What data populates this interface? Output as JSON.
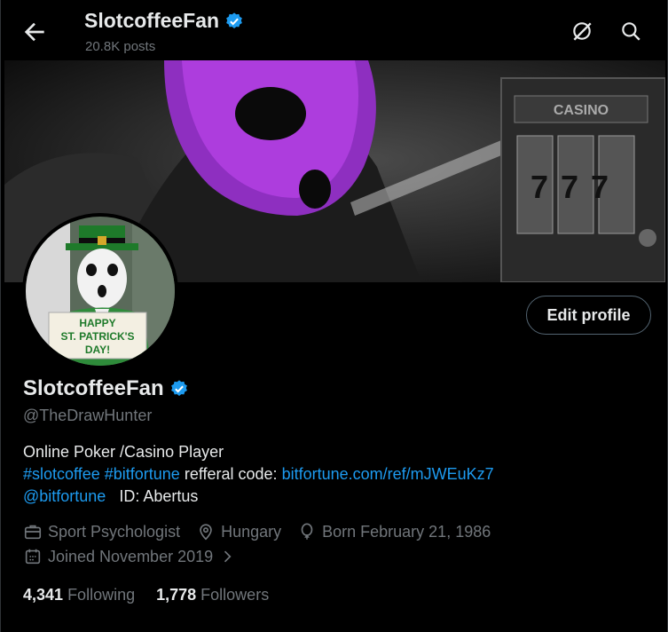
{
  "header": {
    "title": "SlotcoffeeFan",
    "posts": "20.8K posts"
  },
  "profile": {
    "edit_label": "Edit profile",
    "name": "SlotcoffeeFan",
    "handle": "@TheDrawHunter",
    "avatar_sign": [
      "HAPPY",
      "ST. PATRICK'S",
      "DAY!"
    ],
    "banner_sign": "CASINO",
    "banner_reels": "777",
    "bio": {
      "line1": "Online Poker /Casino Player",
      "hashtag1": "#slotcoffee",
      "hashtag2": "#bitfortune",
      "referral_text": "refferal code:",
      "referral_link": "bitfortune.com/ref/mJWEuKz7",
      "mention": "@bitfortune",
      "id_text": "ID: Abertus"
    },
    "meta": {
      "profession": "Sport Psychologist",
      "location": "Hungary",
      "birthday": "Born February 21, 1986",
      "joined": "Joined November 2019"
    },
    "following_count": "4,341",
    "following_label": "Following",
    "followers_count": "1,778",
    "followers_label": "Followers"
  },
  "colors": {
    "accent": "#1d9bf0",
    "text": "#e7e9ea",
    "muted": "#71767b",
    "background": "#000000",
    "balaclava": "#b03fe0"
  },
  "icons": [
    "back-arrow-icon",
    "grok-icon",
    "search-icon",
    "verified-badge-icon",
    "briefcase-icon",
    "location-pin-icon",
    "balloon-icon",
    "calendar-icon",
    "chevron-right-icon"
  ]
}
